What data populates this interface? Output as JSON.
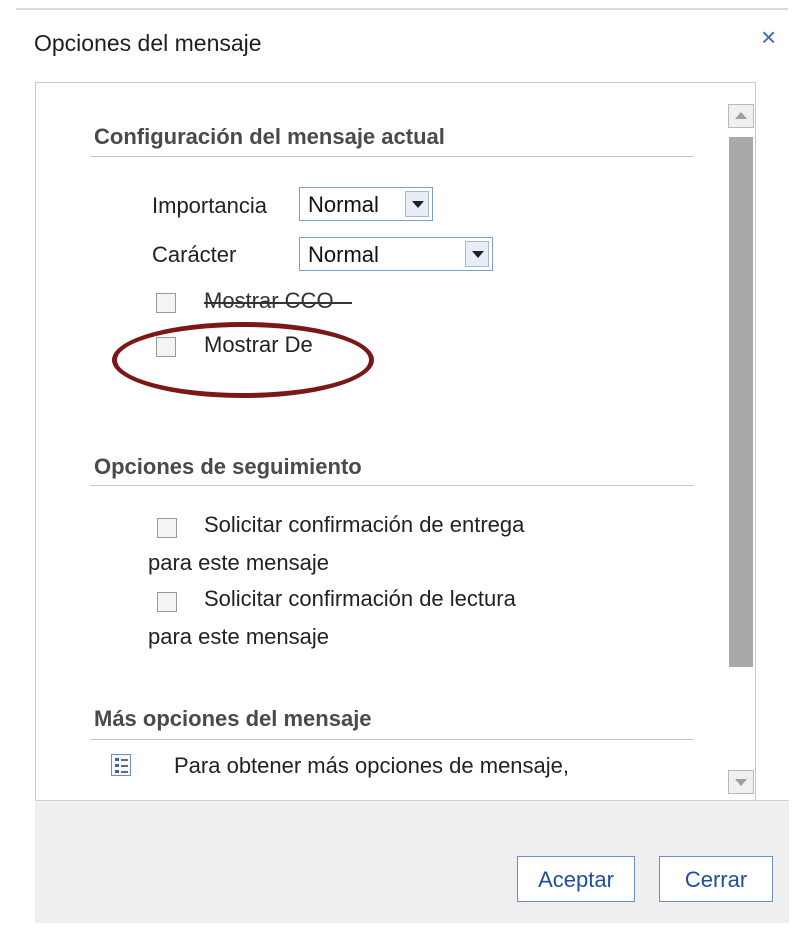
{
  "dialog": {
    "title": "Opciones del mensaje",
    "close_symbol": "×"
  },
  "current_message": {
    "section_title": "Configuración del mensaje actual",
    "importance": {
      "label": "Importancia",
      "value": "Normal"
    },
    "character": {
      "label": "Carácter",
      "value": "Normal"
    },
    "show_bcc": {
      "label": "Mostrar CCO",
      "checked": false
    },
    "show_from": {
      "label": "Mostrar De",
      "checked": false
    }
  },
  "tracking": {
    "section_title": "Opciones de seguimiento",
    "delivery_receipt": {
      "label_line1": "Solicitar confirmación de entrega",
      "label_line2": "para este mensaje",
      "checked": false
    },
    "read_receipt": {
      "label_line1": "Solicitar confirmación de lectura",
      "label_line2": "para este mensaje",
      "checked": false
    }
  },
  "more_options": {
    "section_title": "Más opciones del mensaje",
    "text": "Para obtener más opciones de mensaje,",
    "icon": "list-icon"
  },
  "footer": {
    "accept_label": "Aceptar",
    "close_label": "Cerrar"
  },
  "colors": {
    "accent": "#3d6bb5",
    "annotation_circle": "#7a1818"
  }
}
